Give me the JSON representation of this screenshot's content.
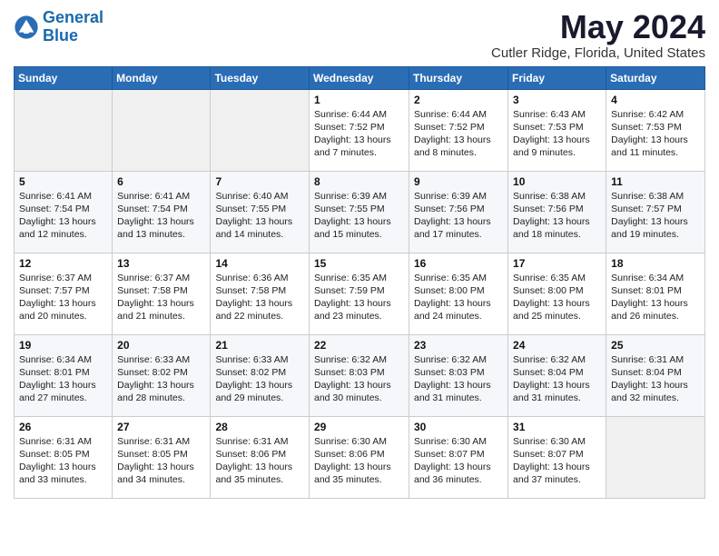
{
  "logo": {
    "line1": "General",
    "line2": "Blue"
  },
  "title": "May 2024",
  "subtitle": "Cutler Ridge, Florida, United States",
  "weekdays": [
    "Sunday",
    "Monday",
    "Tuesday",
    "Wednesday",
    "Thursday",
    "Friday",
    "Saturday"
  ],
  "weeks": [
    [
      {
        "day": "",
        "info": ""
      },
      {
        "day": "",
        "info": ""
      },
      {
        "day": "",
        "info": ""
      },
      {
        "day": "1",
        "info": "Sunrise: 6:44 AM\nSunset: 7:52 PM\nDaylight: 13 hours\nand 7 minutes."
      },
      {
        "day": "2",
        "info": "Sunrise: 6:44 AM\nSunset: 7:52 PM\nDaylight: 13 hours\nand 8 minutes."
      },
      {
        "day": "3",
        "info": "Sunrise: 6:43 AM\nSunset: 7:53 PM\nDaylight: 13 hours\nand 9 minutes."
      },
      {
        "day": "4",
        "info": "Sunrise: 6:42 AM\nSunset: 7:53 PM\nDaylight: 13 hours\nand 11 minutes."
      }
    ],
    [
      {
        "day": "5",
        "info": "Sunrise: 6:41 AM\nSunset: 7:54 PM\nDaylight: 13 hours\nand 12 minutes."
      },
      {
        "day": "6",
        "info": "Sunrise: 6:41 AM\nSunset: 7:54 PM\nDaylight: 13 hours\nand 13 minutes."
      },
      {
        "day": "7",
        "info": "Sunrise: 6:40 AM\nSunset: 7:55 PM\nDaylight: 13 hours\nand 14 minutes."
      },
      {
        "day": "8",
        "info": "Sunrise: 6:39 AM\nSunset: 7:55 PM\nDaylight: 13 hours\nand 15 minutes."
      },
      {
        "day": "9",
        "info": "Sunrise: 6:39 AM\nSunset: 7:56 PM\nDaylight: 13 hours\nand 17 minutes."
      },
      {
        "day": "10",
        "info": "Sunrise: 6:38 AM\nSunset: 7:56 PM\nDaylight: 13 hours\nand 18 minutes."
      },
      {
        "day": "11",
        "info": "Sunrise: 6:38 AM\nSunset: 7:57 PM\nDaylight: 13 hours\nand 19 minutes."
      }
    ],
    [
      {
        "day": "12",
        "info": "Sunrise: 6:37 AM\nSunset: 7:57 PM\nDaylight: 13 hours\nand 20 minutes."
      },
      {
        "day": "13",
        "info": "Sunrise: 6:37 AM\nSunset: 7:58 PM\nDaylight: 13 hours\nand 21 minutes."
      },
      {
        "day": "14",
        "info": "Sunrise: 6:36 AM\nSunset: 7:58 PM\nDaylight: 13 hours\nand 22 minutes."
      },
      {
        "day": "15",
        "info": "Sunrise: 6:35 AM\nSunset: 7:59 PM\nDaylight: 13 hours\nand 23 minutes."
      },
      {
        "day": "16",
        "info": "Sunrise: 6:35 AM\nSunset: 8:00 PM\nDaylight: 13 hours\nand 24 minutes."
      },
      {
        "day": "17",
        "info": "Sunrise: 6:35 AM\nSunset: 8:00 PM\nDaylight: 13 hours\nand 25 minutes."
      },
      {
        "day": "18",
        "info": "Sunrise: 6:34 AM\nSunset: 8:01 PM\nDaylight: 13 hours\nand 26 minutes."
      }
    ],
    [
      {
        "day": "19",
        "info": "Sunrise: 6:34 AM\nSunset: 8:01 PM\nDaylight: 13 hours\nand 27 minutes."
      },
      {
        "day": "20",
        "info": "Sunrise: 6:33 AM\nSunset: 8:02 PM\nDaylight: 13 hours\nand 28 minutes."
      },
      {
        "day": "21",
        "info": "Sunrise: 6:33 AM\nSunset: 8:02 PM\nDaylight: 13 hours\nand 29 minutes."
      },
      {
        "day": "22",
        "info": "Sunrise: 6:32 AM\nSunset: 8:03 PM\nDaylight: 13 hours\nand 30 minutes."
      },
      {
        "day": "23",
        "info": "Sunrise: 6:32 AM\nSunset: 8:03 PM\nDaylight: 13 hours\nand 31 minutes."
      },
      {
        "day": "24",
        "info": "Sunrise: 6:32 AM\nSunset: 8:04 PM\nDaylight: 13 hours\nand 31 minutes."
      },
      {
        "day": "25",
        "info": "Sunrise: 6:31 AM\nSunset: 8:04 PM\nDaylight: 13 hours\nand 32 minutes."
      }
    ],
    [
      {
        "day": "26",
        "info": "Sunrise: 6:31 AM\nSunset: 8:05 PM\nDaylight: 13 hours\nand 33 minutes."
      },
      {
        "day": "27",
        "info": "Sunrise: 6:31 AM\nSunset: 8:05 PM\nDaylight: 13 hours\nand 34 minutes."
      },
      {
        "day": "28",
        "info": "Sunrise: 6:31 AM\nSunset: 8:06 PM\nDaylight: 13 hours\nand 35 minutes."
      },
      {
        "day": "29",
        "info": "Sunrise: 6:30 AM\nSunset: 8:06 PM\nDaylight: 13 hours\nand 35 minutes."
      },
      {
        "day": "30",
        "info": "Sunrise: 6:30 AM\nSunset: 8:07 PM\nDaylight: 13 hours\nand 36 minutes."
      },
      {
        "day": "31",
        "info": "Sunrise: 6:30 AM\nSunset: 8:07 PM\nDaylight: 13 hours\nand 37 minutes."
      },
      {
        "day": "",
        "info": ""
      }
    ]
  ]
}
